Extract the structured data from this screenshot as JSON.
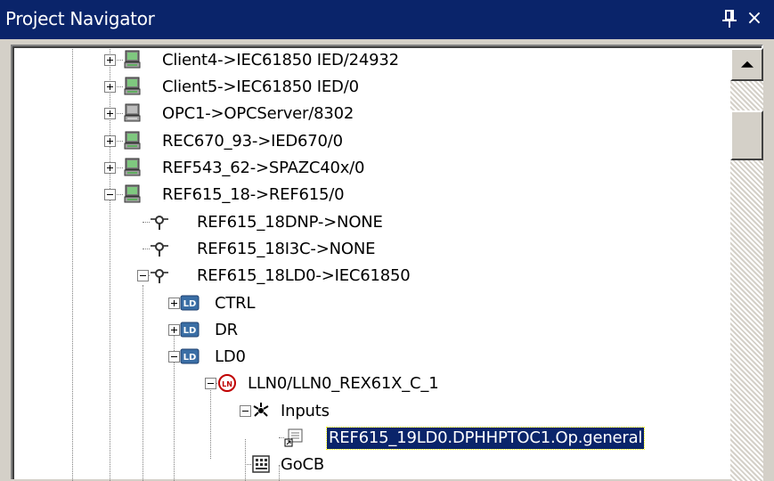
{
  "window": {
    "title": "Project Navigator",
    "pin_icon": "pin-icon",
    "close_icon": "close-icon",
    "close_glyph": "×"
  },
  "tree": {
    "nodes": [
      {
        "label": "Client4->IEC61850 IED/24932",
        "icon": "computer-icon",
        "expanded": false
      },
      {
        "label": "Client5->IEC61850 IED/0",
        "icon": "computer-icon",
        "expanded": false
      },
      {
        "label": "OPC1->OPCServer/8302",
        "icon": "computer-gray-icon",
        "expanded": false
      },
      {
        "label": "REC670_93->IED670/0",
        "icon": "computer-icon",
        "expanded": false
      },
      {
        "label": "REF543_62->SPAZC40x/0",
        "icon": "computer-icon",
        "expanded": false
      },
      {
        "label": "REF615_18->REF615/0",
        "icon": "computer-icon",
        "expanded": true
      },
      {
        "label": "REF615_18DNP->NONE",
        "icon": "access-point-icon"
      },
      {
        "label": "REF615_18I3C->NONE",
        "icon": "access-point-icon"
      },
      {
        "label": "REF615_18LD0->IEC61850",
        "icon": "access-point-icon",
        "expanded": true
      },
      {
        "label": "CTRL",
        "icon": "logical-device-icon",
        "expanded": false
      },
      {
        "label": "DR",
        "icon": "logical-device-icon",
        "expanded": false
      },
      {
        "label": "LD0",
        "icon": "logical-device-icon",
        "expanded": true
      },
      {
        "label": "LLN0/LLN0_REX61X_C_1",
        "icon": "logical-node-icon",
        "expanded": true
      },
      {
        "label": "Inputs",
        "icon": "inputs-icon",
        "expanded": true
      },
      {
        "label": "REF615_19LD0.DPHHPTOC1.Op.general",
        "icon": "input-signal-icon",
        "selected": true
      },
      {
        "label": "GoCB",
        "icon": "goose-control-block-icon"
      }
    ]
  },
  "scrollbar": {
    "up_icon": "scroll-up-arrow-icon"
  },
  "colors": {
    "title_bar": "#0a246a",
    "selection": "#0a246a",
    "panel": "#ffffff",
    "chrome": "#d4d0c8"
  }
}
